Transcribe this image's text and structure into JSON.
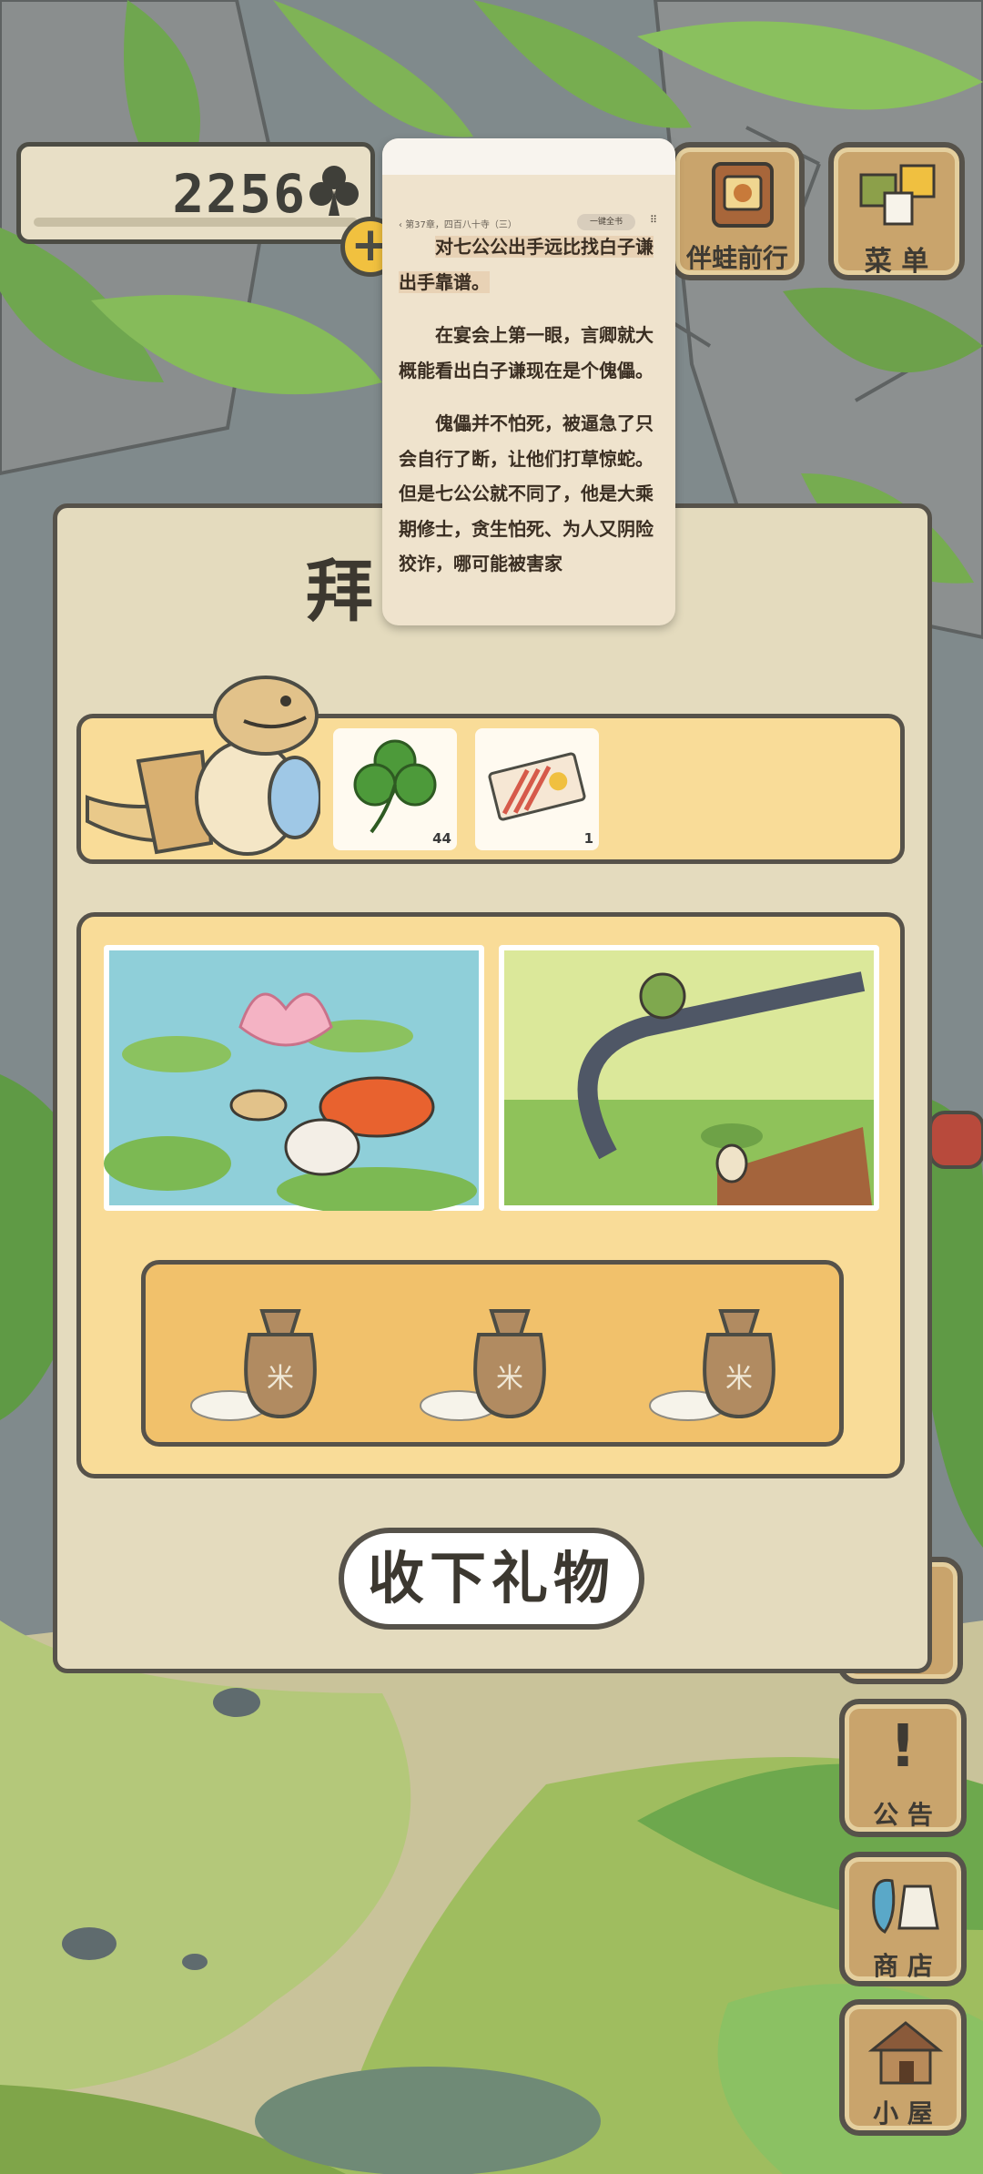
{
  "hud": {
    "clover_count": "2256",
    "clover_symbol": "♣",
    "plus_label": "+"
  },
  "top_buttons": {
    "travel_with_frog": "伴蛙前行",
    "menu": "菜 单"
  },
  "side_buttons": {
    "notice": "公 告",
    "notice_glyph": "!",
    "shop": "商 店",
    "house": "小 屋"
  },
  "reader": {
    "chapter": "第37章，四百八十寺（三）",
    "pill": "一键全书",
    "dots": "⠿",
    "paragraphs": [
      "对七公公出手远比找白子谦出手靠谱。",
      "在宴会上第一眼，言卿就大概能看出白子谦现在是个傀儡。",
      "傀儡并不怕死，被逼急了只会自行了断，让他们打草惊蛇。但是七公公就不同了，他是大乘期修士，贪生怕死、为人又阴险狡诈，哪可能被害家"
    ]
  },
  "gift_panel": {
    "title_peek": "拜",
    "items": [
      {
        "name": "clover",
        "count": "44"
      },
      {
        "name": "ticket",
        "count": "1"
      }
    ],
    "rice_bag_char": "米",
    "accept_button": "收下礼物"
  },
  "colors": {
    "panel": "#e4dbbe",
    "accent_yellow": "#f9dc98",
    "outline": "#56524a",
    "wood": "#c9a46c"
  }
}
